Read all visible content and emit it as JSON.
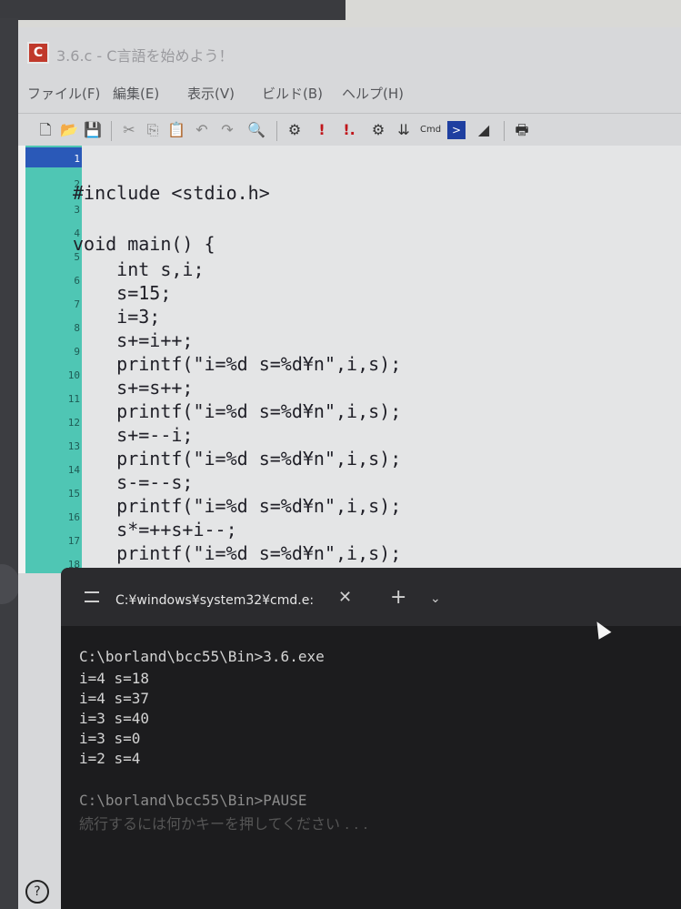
{
  "window": {
    "app_icon_letter": "C",
    "title": "3.6.c - C言語を始めよう！"
  },
  "menu": [
    {
      "label": "ファイル(F)"
    },
    {
      "label": "編集(E)"
    },
    {
      "label": "表示(V)"
    },
    {
      "label": "ビルド(B)"
    },
    {
      "label": "ヘルプ(H)"
    }
  ],
  "toolbar": [
    {
      "name": "new-file-icon",
      "glyph": "🗋"
    },
    {
      "name": "open-folder-icon",
      "glyph": "📂"
    },
    {
      "name": "save-icon",
      "glyph": "💾"
    },
    {
      "name": "cut-icon",
      "glyph": "✂"
    },
    {
      "name": "copy-icon",
      "glyph": "⎘"
    },
    {
      "name": "paste-icon",
      "glyph": "📋"
    },
    {
      "name": "undo-icon",
      "glyph": "↶"
    },
    {
      "name": "redo-icon",
      "glyph": "↷"
    },
    {
      "name": "find-icon",
      "glyph": "🔍"
    },
    {
      "name": "compile-icon",
      "glyph": "⚙"
    },
    {
      "name": "run-icon",
      "glyph": "!"
    },
    {
      "name": "build-run-icon",
      "glyph": "!."
    },
    {
      "name": "stack-icon",
      "glyph": "⚙"
    },
    {
      "name": "download-icon",
      "glyph": "⇊"
    },
    {
      "name": "cmd-icon",
      "glyph": "Cmd"
    },
    {
      "name": "terminal-icon",
      "glyph": ">"
    },
    {
      "name": "build-options-icon",
      "glyph": "◢"
    },
    {
      "name": "print-icon",
      "glyph": "🖶"
    }
  ],
  "code": {
    "active_line": "1",
    "lines": [
      {
        "n": "1",
        "text": "#include <stdio.h>"
      },
      {
        "n": "2",
        "text": ""
      },
      {
        "n": "3",
        "text": "void main() {"
      },
      {
        "n": "4",
        "text": "    int s,i;"
      },
      {
        "n": "5",
        "text": "    s=15;"
      },
      {
        "n": "6",
        "text": "    i=3;"
      },
      {
        "n": "7",
        "text": "    s+=i++;"
      },
      {
        "n": "8",
        "text": "    printf(\"i=%d s=%d¥n\",i,s);"
      },
      {
        "n": "9",
        "text": "    s+=s++;"
      },
      {
        "n": "10",
        "text": "    printf(\"i=%d s=%d¥n\",i,s);"
      },
      {
        "n": "11",
        "text": "    s+=--i;"
      },
      {
        "n": "12",
        "text": "    printf(\"i=%d s=%d¥n\",i,s);"
      },
      {
        "n": "13",
        "text": "    s-=--s;"
      },
      {
        "n": "14",
        "text": "    printf(\"i=%d s=%d¥n\",i,s);"
      },
      {
        "n": "15",
        "text": "    s*=++s+i--;"
      },
      {
        "n": "16",
        "text": "    printf(\"i=%d s=%d¥n\",i,s);"
      },
      {
        "n": "17",
        "text": "}"
      },
      {
        "n": "18",
        "text": ""
      }
    ]
  },
  "console": {
    "tab_title": "C:¥windows¥system32¥cmd.e:",
    "close_glyph": "✕",
    "plus_glyph": "+",
    "chevron_glyph": "⌄",
    "lines": [
      {
        "text": "C:\\borland\\bcc55\\Bin>3.6.exe",
        "style": ""
      },
      {
        "text": "i=4 s=18",
        "style": ""
      },
      {
        "text": "i=4 s=37",
        "style": ""
      },
      {
        "text": "i=3 s=40",
        "style": ""
      },
      {
        "text": "i=3 s=0",
        "style": ""
      },
      {
        "text": "i=2 s=4",
        "style": ""
      },
      {
        "text": "",
        "style": ""
      },
      {
        "text": "C:\\borland\\bcc55\\Bin>PAUSE",
        "style": "dim"
      },
      {
        "text": "続行するには何かキーを押してください . . .",
        "style": "dimmer"
      }
    ]
  }
}
